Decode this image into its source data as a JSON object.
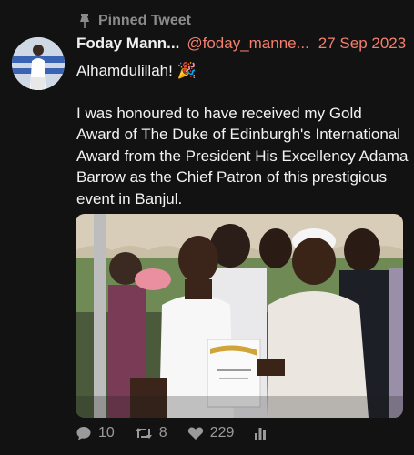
{
  "pinned": {
    "label": "Pinned Tweet",
    "icon": "pin-icon"
  },
  "tweet": {
    "author_name": "Foday Mann...",
    "author_handle": "@foday_manne...",
    "date": "27 Sep 2023",
    "line1": "Alhamdulillah! 🎉",
    "paragraph": "I was honoured to have received my Gold Award of The Duke of Edinburgh's International Award from the President His Excellency Adama Barrow as the Chief Patron of this prestigious event in Banjul."
  },
  "actions": {
    "replies": "10",
    "retweets": "8",
    "likes": "229"
  },
  "colors": {
    "background": "#121212",
    "accent": "#f47f6f",
    "muted": "#8b8b8b"
  }
}
